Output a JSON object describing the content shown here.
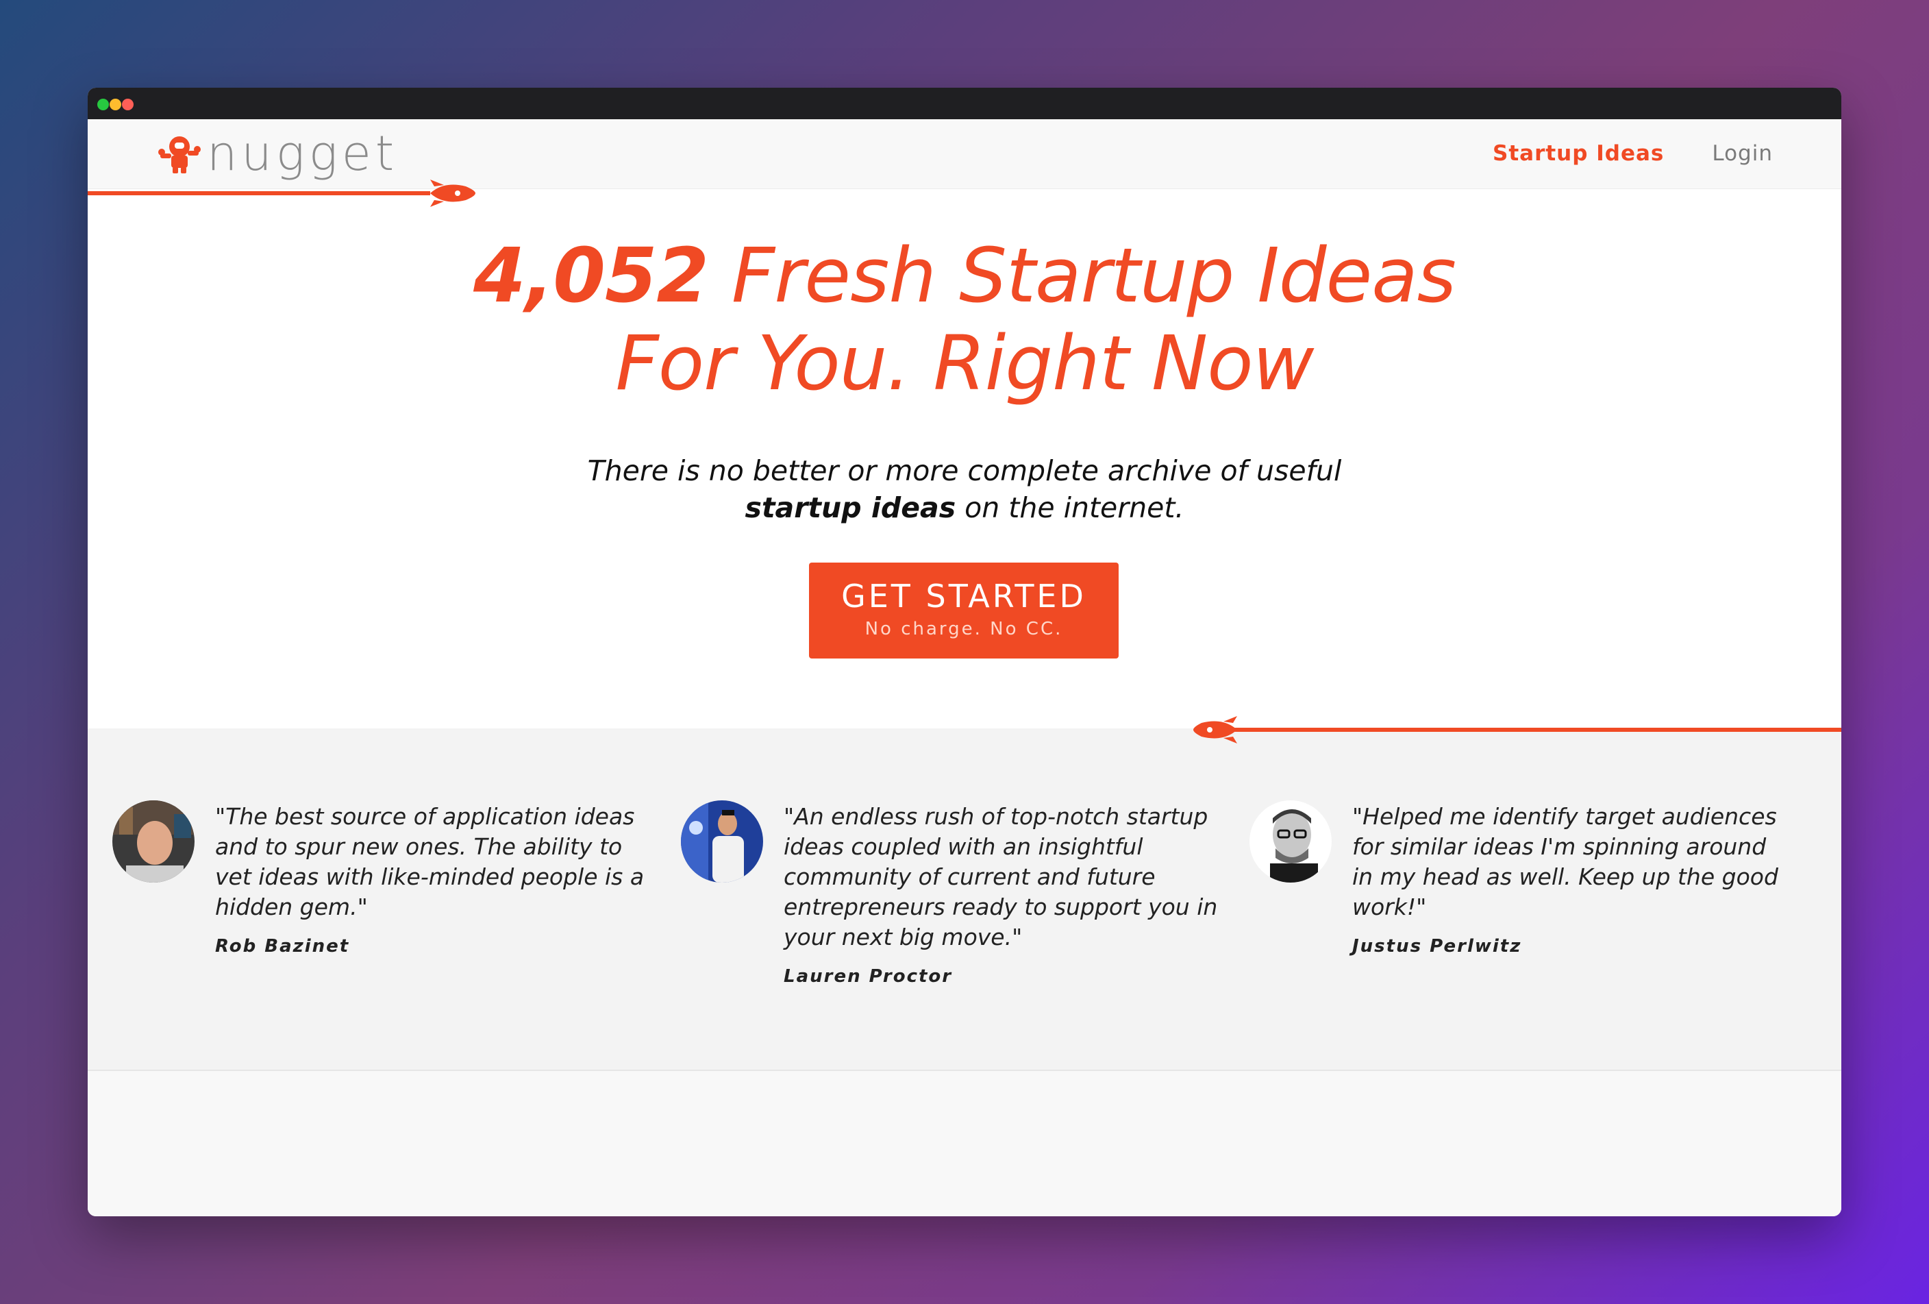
{
  "window": {
    "controls": [
      "close",
      "minimize",
      "maximize"
    ]
  },
  "navbar": {
    "logo_text": "nugget",
    "logo_icon": "astronaut-icon",
    "links": [
      {
        "label": "Startup Ideas",
        "active": true
      },
      {
        "label": "Login",
        "active": false
      }
    ]
  },
  "hero": {
    "count": "4,052",
    "headline_rest": " Fresh Startup Ideas",
    "headline_line2": "For You. Right Now",
    "subline_part1": "There is no better or more complete archive of useful",
    "subline_bold": "startup ideas",
    "subline_part2": " on the internet.",
    "cta_label": "GET STARTED",
    "cta_sublabel": "No charge. No CC."
  },
  "testimonials": [
    {
      "quote": "\"The best source of application ideas and to spur new ones. The ability to vet ideas with like-minded people is a hidden gem.\"",
      "author": "Rob Bazinet"
    },
    {
      "quote": "\"An endless rush of top-notch startup ideas coupled with an insightful community of current and future entrepreneurs ready to support you in your next big move.\"",
      "author": "Lauren Proctor"
    },
    {
      "quote": "\"Helped me identify target audiences for similar ideas I'm spinning around in my head as well. Keep up the good work!\"",
      "author": "Justus Perlwitz"
    }
  ],
  "colors": {
    "accent": "#f04a24",
    "nav_bg": "#f8f8f8",
    "testimonials_bg": "#f3f3f3",
    "titlebar": "#1f1f22"
  }
}
